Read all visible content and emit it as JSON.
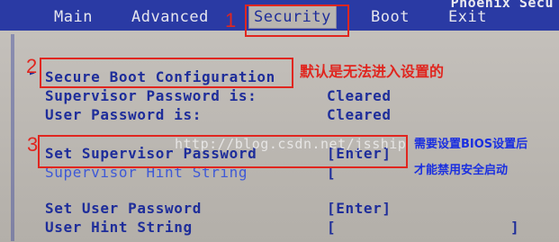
{
  "bios": {
    "vendor": "Phoenix Secu",
    "tabs": [
      {
        "label": "Main"
      },
      {
        "label": "Advanced"
      },
      {
        "label": "Security"
      },
      {
        "label": "Boot"
      },
      {
        "label": "Exit"
      }
    ],
    "active_tab": "Security",
    "items": [
      {
        "label": "Secure Boot Configuration",
        "value": ""
      },
      {
        "label": "Supervisor Password is:",
        "value": "Cleared"
      },
      {
        "label": "User Password is:",
        "value": "Cleared"
      },
      {
        "label": "Set Supervisor Password",
        "value": "Enter"
      },
      {
        "label": "Supervisor Hint String",
        "value": "["
      },
      {
        "label": "Set User Password",
        "value": "[Enter]"
      },
      {
        "label": "User Hint String",
        "value": "["
      }
    ],
    "bracket_open": "[",
    "bracket_close": "]",
    "hint_end": "]",
    "arrow": "►"
  },
  "watermark": "http://blog.csdn.net/jsship",
  "annotations": {
    "numbers": [
      "1",
      "2",
      "3"
    ],
    "note_secure_boot": "默认是无法进入设置的",
    "note_set_password_line1": "需要设置BIOS设置后",
    "note_set_password_line2": "才能禁用安全启动"
  },
  "colors": {
    "menu_bg": "#2a3aa4",
    "panel_bg": "#b9b5b0",
    "text_blue": "#1e2d9a",
    "annotation_red": "#e0261f",
    "annotation_blue": "#1a2fe0"
  }
}
